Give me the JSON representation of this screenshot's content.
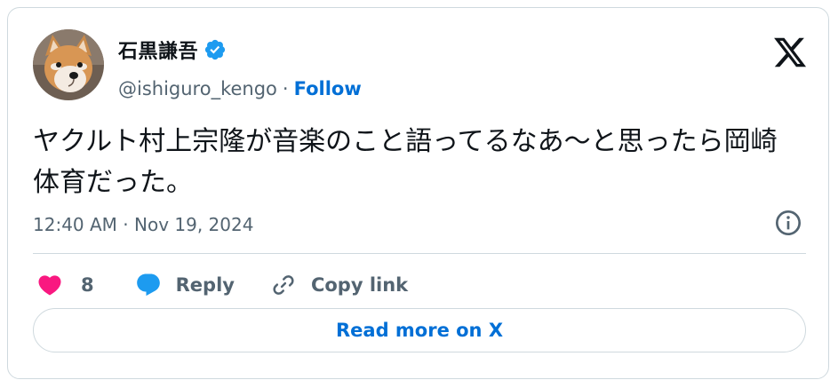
{
  "author": {
    "display_name": "石黒謙吾",
    "handle": "@ishiguro_kengo",
    "verified": true,
    "avatar_icon": "shiba-dog-avatar"
  },
  "follow_separator": "·",
  "follow_label": "Follow",
  "tweet": {
    "text": "ヤクルト村上宗隆が音楽のこと語ってるなあ〜と思ったら岡崎体育だった。",
    "timestamp": "12:40 AM · Nov 19, 2024"
  },
  "actions": {
    "like_count": "8",
    "reply_label": "Reply",
    "copy_label": "Copy link"
  },
  "read_more_label": "Read more on X",
  "colors": {
    "like": "#f91880",
    "reply": "#1d9bf0",
    "link": "#006fd6",
    "muted": "#536471",
    "text": "#0f1419",
    "border": "#cfd9de"
  }
}
